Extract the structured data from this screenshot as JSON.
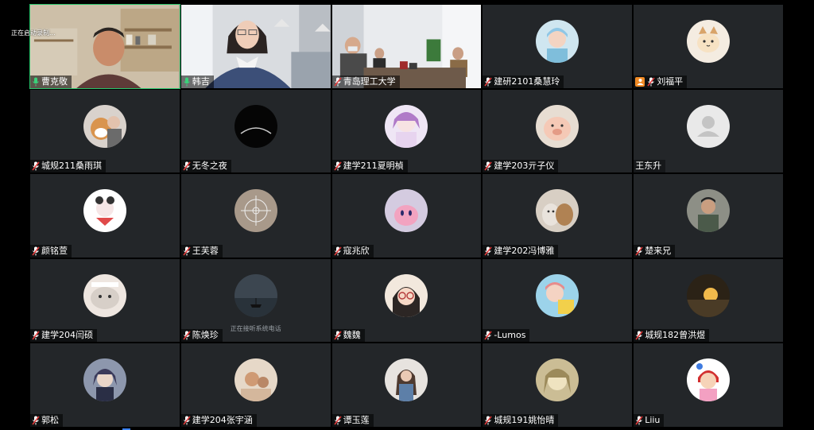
{
  "meeting": {
    "recording_status": "正在启动录制..."
  },
  "participants": [
    {
      "name": "曹克敬",
      "mic": "on",
      "kind": "video-teacher",
      "active": true
    },
    {
      "name": "韩吉",
      "mic": "on",
      "kind": "video-woman"
    },
    {
      "name": "青岛理工大学",
      "mic": "off",
      "kind": "video-room"
    },
    {
      "name": "建研2101桑慧玲",
      "mic": "off",
      "kind": "avatar",
      "avatar": "girl-blue"
    },
    {
      "name": "刘福平",
      "mic": "off",
      "kind": "avatar",
      "avatar": "cat",
      "host": true
    },
    {
      "name": "城规211桑雨琪",
      "mic": "off",
      "kind": "avatar",
      "avatar": "dog"
    },
    {
      "name": "无冬之夜",
      "mic": "off",
      "kind": "avatar",
      "avatar": "moon"
    },
    {
      "name": "建学211夏明楨",
      "mic": "off",
      "kind": "avatar",
      "avatar": "anime-purple"
    },
    {
      "name": "建学203亓子仪",
      "mic": "off",
      "kind": "avatar",
      "avatar": "pig"
    },
    {
      "name": "王东升",
      "mic": "none",
      "kind": "avatar",
      "avatar": "default"
    },
    {
      "name": "颜铭萱",
      "mic": "off",
      "kind": "avatar",
      "avatar": "cartoon-white"
    },
    {
      "name": "王芙蓉",
      "mic": "off",
      "kind": "avatar",
      "avatar": "compass"
    },
    {
      "name": "寇兆欣",
      "mic": "off",
      "kind": "avatar",
      "avatar": "kirby"
    },
    {
      "name": "建学202冯博雅",
      "mic": "off",
      "kind": "avatar",
      "avatar": "cats"
    },
    {
      "name": "楚来兄",
      "mic": "off",
      "kind": "avatar",
      "avatar": "man-photo"
    },
    {
      "name": "建学204闫硕",
      "mic": "off",
      "kind": "avatar",
      "avatar": "meme-cat"
    },
    {
      "name": "陈焕珍",
      "mic": "off",
      "kind": "avatar",
      "avatar": "sea",
      "status": "正在接听系统电话"
    },
    {
      "name": "魏魏",
      "mic": "off",
      "kind": "avatar",
      "avatar": "girl-glasses"
    },
    {
      "name": "-Lumos",
      "mic": "off",
      "kind": "avatar",
      "avatar": "anime-sky"
    },
    {
      "name": "城规182曾洪煜",
      "mic": "off",
      "kind": "avatar",
      "avatar": "sunset"
    },
    {
      "name": "郭松",
      "mic": "off",
      "kind": "avatar",
      "avatar": "anime-boy"
    },
    {
      "name": "建学204张宇涵",
      "mic": "off",
      "kind": "avatar",
      "avatar": "bear-toys"
    },
    {
      "name": "谭玉莲",
      "mic": "off",
      "kind": "avatar",
      "avatar": "girl-photo"
    },
    {
      "name": "城规191姚怡晴",
      "mic": "off",
      "kind": "avatar",
      "avatar": "sketch"
    },
    {
      "name": "Liiu",
      "mic": "off",
      "kind": "avatar",
      "avatar": "cartoon-girl"
    }
  ]
}
